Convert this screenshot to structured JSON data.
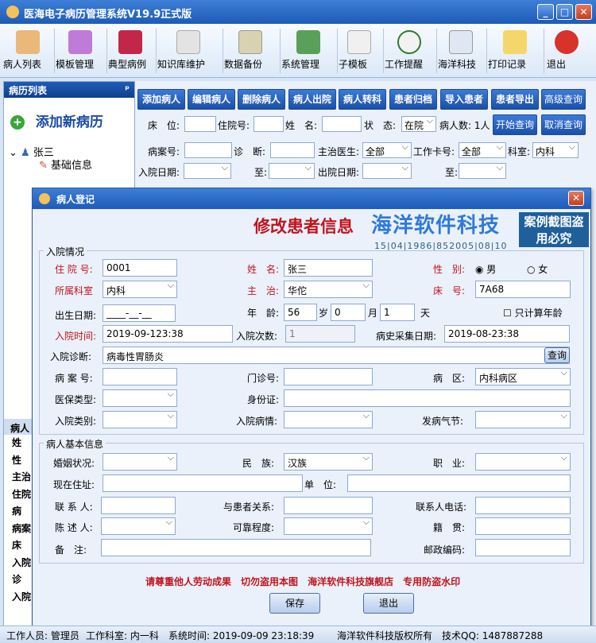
{
  "app": {
    "title": "医海电子病历管理系统V19.9正式版"
  },
  "window_controls": {
    "min": "_",
    "max": "□",
    "close": "✕"
  },
  "toolbar": [
    {
      "label": "病人列表",
      "icon": "patient-list-icon"
    },
    {
      "label": "模板管理",
      "icon": "template-icon"
    },
    {
      "label": "典型病例",
      "icon": "books-icon"
    },
    {
      "label": "知识库维护",
      "icon": "knowledge-icon"
    },
    {
      "label": "数据备份",
      "icon": "backup-icon"
    },
    {
      "label": "系统管理",
      "icon": "system-icon"
    },
    {
      "label": "子模板",
      "icon": "subtemplate-icon"
    },
    {
      "label": "工作提醒",
      "icon": "clock-icon"
    },
    {
      "label": "海洋科技",
      "icon": "news-icon"
    },
    {
      "label": "打印记录",
      "icon": "print-record-icon"
    },
    {
      "label": "退出",
      "icon": "power-icon"
    }
  ],
  "left_panel": {
    "header": "病历列表",
    "pin": "ᵖ",
    "add_new": "添加新病历",
    "tree": {
      "root": "张三",
      "child": "基础信息"
    },
    "bottom_labels": [
      "病人",
      "姓",
      "性",
      "主治",
      "住院",
      "病",
      "病案",
      "床",
      "入院",
      "诊",
      "入院"
    ]
  },
  "query": {
    "buttons": [
      "添加病人",
      "编辑病人",
      "删除病人",
      "病人出院",
      "病人转科",
      "患者归档",
      "导入患者",
      "患者导出",
      "高级查询",
      "开始查询",
      "取消查询"
    ],
    "labels": {
      "bed": "床　位:",
      "admission_no": "住院号:",
      "name": "姓　名:",
      "status": "状　态:",
      "status_value": "在院",
      "patient_count": "病人数: 1人",
      "record_no": "病案号:",
      "diagnosis": "诊　断:",
      "doctor": "主治医生:",
      "doctor_value": "全部",
      "card_no": "工作卡号:",
      "card_value": "全部",
      "dept": "科室:",
      "dept_value": "内科",
      "admit_date": "入院日期:",
      "to": "至:",
      "discharge_date": "出院日期:"
    }
  },
  "dialog": {
    "title": "病人登记",
    "close": "✕",
    "banner": "修改患者信息",
    "watermark_brand": "海洋软件科技",
    "watermark_stamp": "案例截图盗用必究",
    "watermark_code": "15|04|1986|852005|08|10",
    "group1": "入院情况",
    "fields": {
      "admission_no_label": "住 院 号:",
      "admission_no": "0001",
      "name_label": "姓　名:",
      "name": "张三",
      "gender_label": "性　别:",
      "gender_male": "男",
      "gender_female": "女",
      "dept_label": "所属科室",
      "dept": "内科",
      "doctor_label": "主　治:",
      "doctor": "华佗",
      "bed_label": "床　号:",
      "bed": "7A68",
      "birth_label": "出生日期:",
      "birth": "____-__-__",
      "age_label": "年　龄:",
      "age_years": "56",
      "age_y_unit": "岁",
      "age_months": "0",
      "age_m_unit": "月",
      "age_days": "1",
      "age_d_unit": "天",
      "age_only_label": "只计算年龄",
      "admit_time_label": "入院时间:",
      "admit_time": "2019-09-123:38",
      "admit_count_label": "入院次数:",
      "admit_count": "1",
      "history_date_label": "病史采集日期:",
      "history_date": "2019-08-23:38",
      "diagnosis_label": "入院诊断:",
      "diagnosis": "病毒性胃肠炎",
      "query_btn": "查询",
      "record_no_label": "病 案 号:",
      "clinic_no_label": "门诊号:",
      "ward_label": "病　区:",
      "ward": "内科病区",
      "insurance_label": "医保类型:",
      "id_label": "身份证:",
      "admit_type_label": "入院类别:",
      "admit_cond_label": "入院病情:",
      "season_label": "发病气节:"
    },
    "group2": "病人基本信息",
    "fields2": {
      "marital_label": "婚姻状况:",
      "ethnic_label": "民　族:",
      "ethnic": "汉族",
      "job_label": "职　业:",
      "address_label": "现在住址:",
      "employer_label": "单　位:",
      "contact_label": "联 系 人:",
      "relation_label": "与患者关系:",
      "contact_phone_label": "联系人电话:",
      "narrator_label": "陈 述 人:",
      "reliability_label": "可靠程度:",
      "native_label": "籍　贯:",
      "note_label": "备　注:",
      "postcode_label": "邮政编码:"
    },
    "notice": [
      "请尊重他人劳动成果",
      "切勿盗用本图",
      "海洋软件科技旗舰店",
      "专用防盗水印"
    ],
    "save": "保存",
    "exit": "退出"
  },
  "statusbar": {
    "user": "工作人员: 管理员",
    "dept": "工作科室: 内一科",
    "time": "系统时间:  2019-09-09 23:18:39",
    "copyright": "海洋软件科技版权所有",
    "qq": "技术QQ: 1487887288"
  }
}
